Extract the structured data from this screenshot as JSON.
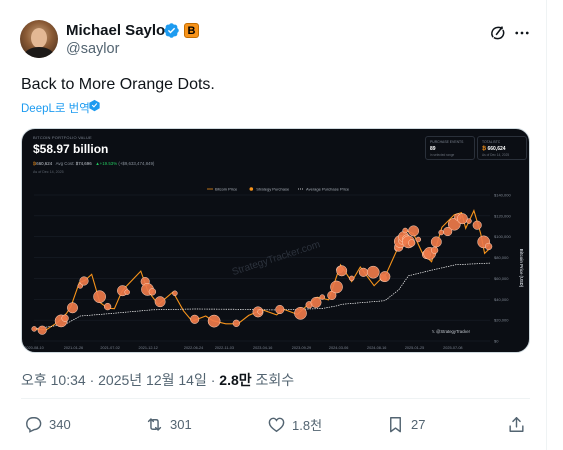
{
  "tweet": {
    "author_name": "Michael Saylor",
    "author_handle": "@saylor",
    "business_badge": "B",
    "text": "Back to More Orange Dots.",
    "translate_label": "DeepL로 번역",
    "timestamp": "오후 10:34 · 2025년 12월 14일 · ",
    "views_count": "2.8만",
    "views_label": " 조회수"
  },
  "actions": {
    "replies": "340",
    "reposts": "301",
    "likes": "1.8천",
    "bookmarks": "27"
  },
  "icons": {
    "verified": "verified-badge-icon",
    "grok": "grok-icon",
    "more": "more-icon",
    "reply": "reply-icon",
    "repost": "repost-icon",
    "like": "like-icon",
    "bookmark": "bookmark-icon",
    "share": "share-icon"
  },
  "colors": {
    "brand_blue": "#1d9bf0",
    "bitcoin_orange": "#f7931a",
    "text_primary": "#0f1419",
    "text_secondary": "#536471"
  },
  "card": {
    "header_label": "BITCOIN PORTFOLIO VALUE",
    "portfolio_value": "$58.97 billion",
    "btc_held": "660,624",
    "avg_cost_label": "Avg Cost:",
    "avg_cost": "$74,696",
    "gain": "+19.53%",
    "gain_detail": "(+$9,633,474,849)",
    "as_of": "As of Dec 14, 2025",
    "box1_title": "PURCHASE EVENTS",
    "box1_value": "89",
    "box1_sub": "in selected range",
    "box2_title": "TOTAL BTC",
    "box2_value": "660,624",
    "box2_sub": "As of Dec 14, 2025",
    "watermark": "StrategyTracker.com",
    "credit": "@StrategyTracker",
    "y_axis_title": "Bitcoin Price (USD)"
  },
  "chart_data": {
    "type": "line",
    "legend": [
      "Bitcoin Price",
      "Strategy Purchase",
      "Average Purchase Price"
    ],
    "legend_position": "top-center",
    "x_tick_labels": [
      "2020-08-10",
      "2021-01-26",
      "2021-07-02",
      "2021-12-12",
      "2022-06-24",
      "2022-11-03",
      "2023-04-16",
      "2023-09-29",
      "2024-03-06",
      "2024-08-16",
      "2025-01-25",
      "2025-07-08"
    ],
    "y_ticks": [
      "$0",
      "$20,000",
      "$40,000",
      "$60,000",
      "$80,000",
      "$100,000",
      "$120,000",
      "$140,000"
    ],
    "ylim": [
      0,
      140000
    ],
    "x_range": [
      "2020-08-10",
      "2025-12-14"
    ],
    "grid": true,
    "series": [
      {
        "name": "Bitcoin Price",
        "color": "#f7931a",
        "x": [
          "2020-08-10",
          "2020-10-01",
          "2020-11-20",
          "2020-12-27",
          "2021-01-15",
          "2021-02-20",
          "2021-03-15",
          "2021-04-14",
          "2021-05-19",
          "2021-06-22",
          "2021-07-20",
          "2021-08-20",
          "2021-09-07",
          "2021-10-20",
          "2021-11-10",
          "2021-12-10",
          "2022-01-24",
          "2022-03-28",
          "2022-05-12",
          "2022-06-18",
          "2022-08-15",
          "2022-09-15",
          "2022-11-09",
          "2022-12-31",
          "2023-02-15",
          "2023-04-14",
          "2023-06-15",
          "2023-07-15",
          "2023-09-11",
          "2023-10-25",
          "2023-12-05",
          "2024-01-23",
          "2024-03-14",
          "2024-05-01",
          "2024-06-07",
          "2024-08-05",
          "2024-09-27",
          "2024-11-12",
          "2024-12-17",
          "2025-01-20",
          "2025-02-28",
          "2025-04-08",
          "2025-05-22",
          "2025-07-14",
          "2025-08-14",
          "2025-09-01",
          "2025-10-06",
          "2025-11-04",
          "2025-11-21",
          "2025-12-14"
        ],
        "y": [
          11600,
          10600,
          18000,
          26500,
          33000,
          56000,
          58000,
          64000,
          37000,
          31500,
          31000,
          47000,
          52000,
          62000,
          67000,
          48000,
          35000,
          47000,
          29000,
          19000,
          24000,
          19500,
          16500,
          16500,
          24500,
          30000,
          25000,
          30500,
          25500,
          34500,
          42000,
          39500,
          73000,
          57000,
          71000,
          53000,
          65000,
          88000,
          106000,
          103000,
          84000,
          76000,
          109000,
          121000,
          123000,
          108000,
          125000,
          103000,
          84000,
          89000
        ]
      },
      {
        "name": "Average Purchase Price",
        "color": "#ffffff",
        "x": [
          "2020-08-10",
          "2020-12-21",
          "2021-02-24",
          "2021-06-21",
          "2021-12-30",
          "2022-06-29",
          "2022-12-24",
          "2023-06-28",
          "2023-12-27",
          "2024-02-26",
          "2024-03-19",
          "2024-09-20",
          "2024-11-18",
          "2024-12-30",
          "2025-03-31",
          "2025-07-21",
          "2025-12-14"
        ],
        "y": [
          11600,
          15900,
          24000,
          26100,
          29900,
          30700,
          30400,
          29700,
          31200,
          33700,
          35200,
          38600,
          49000,
          62500,
          67500,
          73200,
          74700
        ]
      }
    ],
    "purchases": {
      "name": "Strategy Purchase",
      "color": "#f7931a",
      "x": [
        "2020-08-11",
        "2020-09-14",
        "2020-12-04",
        "2020-12-21",
        "2021-01-22",
        "2021-02-24",
        "2021-03-12",
        "2021-05-18",
        "2021-06-21",
        "2021-08-24",
        "2021-09-13",
        "2021-11-29",
        "2021-12-09",
        "2021-12-30",
        "2022-02-01",
        "2022-04-05",
        "2022-06-29",
        "2022-09-20",
        "2022-12-24",
        "2023-03-27",
        "2023-04-05",
        "2023-06-28",
        "2023-09-25",
        "2023-11-01",
        "2023-11-30",
        "2023-12-27",
        "2024-02-06",
        "2024-02-26",
        "2024-03-11",
        "2024-03-19",
        "2024-05-01",
        "2024-06-20",
        "2024-08-01",
        "2024-09-13",
        "2024-09-20",
        "2024-11-11",
        "2024-11-18",
        "2024-11-25",
        "2024-12-02",
        "2024-12-09",
        "2024-12-16",
        "2024-12-23",
        "2024-12-30",
        "2025-01-13",
        "2025-01-21",
        "2025-02-10",
        "2025-03-17",
        "2025-03-31",
        "2025-04-21",
        "2025-04-28",
        "2025-05-19",
        "2025-06-16",
        "2025-07-14",
        "2025-07-29",
        "2025-08-18",
        "2025-09-15",
        "2025-10-20",
        "2025-11-17",
        "2025-12-08"
      ],
      "y": [
        11600,
        10400,
        19300,
        21900,
        31800,
        52800,
        57500,
        42500,
        33000,
        48200,
        46800,
        57000,
        49500,
        47200,
        37700,
        45700,
        20800,
        19100,
        17000,
        27900,
        28000,
        30200,
        26600,
        34700,
        37000,
        42100,
        43700,
        51800,
        68500,
        67300,
        60000,
        65900,
        66000,
        60400,
        61800,
        88600,
        90000,
        95400,
        96000,
        100000,
        106000,
        97800,
        95000,
        94000,
        105600,
        97300,
        82900,
        84000,
        87000,
        95000,
        104000,
        105000,
        112000,
        118900,
        117300,
        115000,
        111000,
        95000,
        90600
      ]
    }
  }
}
